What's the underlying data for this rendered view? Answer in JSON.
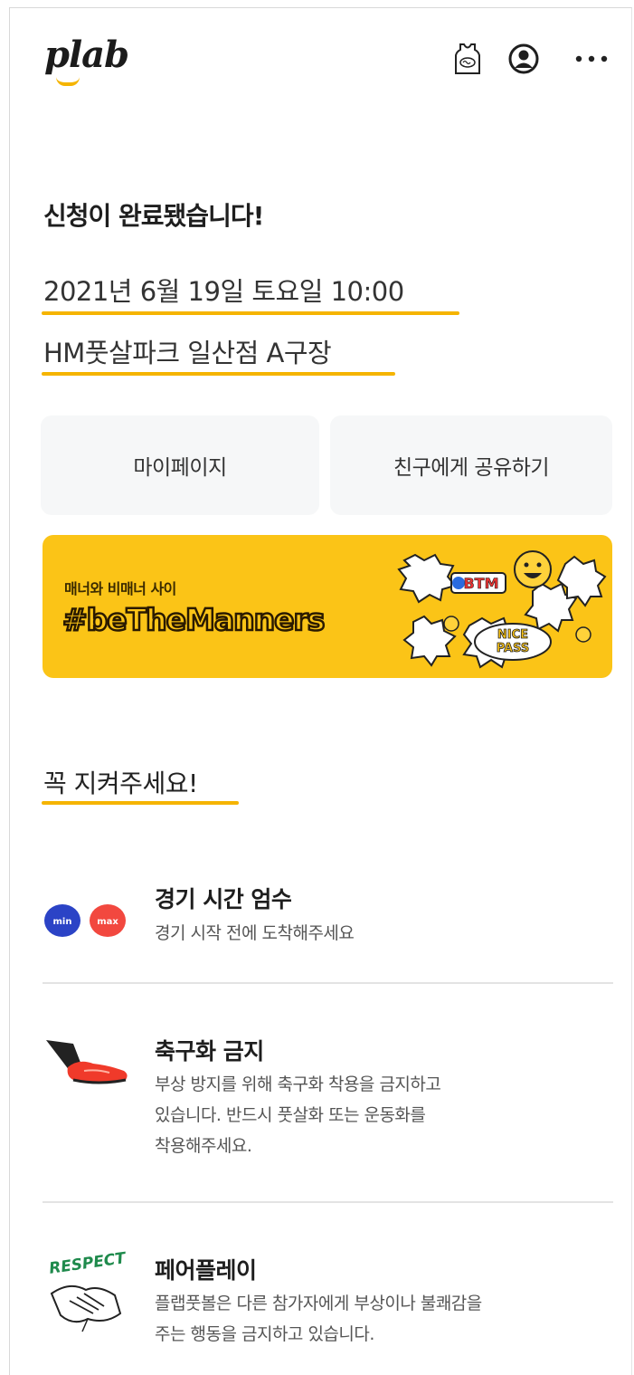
{
  "header": {
    "logo": "plab",
    "icons": [
      "jersey-icon",
      "user-icon",
      "more-icon"
    ]
  },
  "main": {
    "title": "신청이 완료됐습니다!",
    "date": "2021년 6월 19일 토요일 10:00",
    "place": "HM풋살파크 일산점 A구장",
    "buttons": {
      "mypage": "마이페이지",
      "share": "친구에게 공유하기"
    }
  },
  "banner": {
    "subtitle": "매너와 비매너 사이",
    "tag": "#beTheManners"
  },
  "rules": {
    "title": "꼭 지켜주세요!",
    "items": [
      {
        "title": "경기 시간 엄수",
        "desc": "경기 시작 전에 도착해주세요",
        "icon": "min-max-icon"
      },
      {
        "title": "축구화 금지",
        "desc": "부상 방지를 위해 축구화 착용을 금지하고\n있습니다. 반드시 풋살화 또는 운동화를\n착용해주세요.",
        "icon": "soccer-shoe-icon"
      },
      {
        "title": "페어플레이",
        "desc": "플랩풋볼은 다른 참가자에게 부상이나 불쾌감을\n주는 행동을 금지하고 있습니다.",
        "icon": "respect-handshake-icon"
      }
    ]
  },
  "colors": {
    "accent": "#f5b400",
    "banner": "#fbc417",
    "button_bg": "#f6f7f8"
  }
}
